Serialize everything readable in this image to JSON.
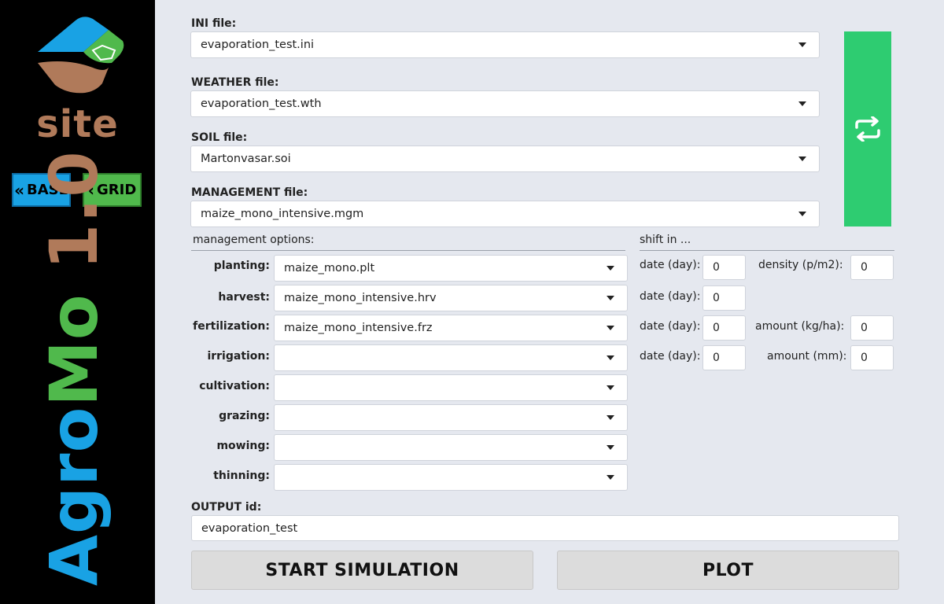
{
  "sidebar": {
    "site_text": "site",
    "base_label": "BASE",
    "grid_label": "GRID",
    "brand_part1": "Agro",
    "brand_part2": "Mo",
    "brand_part3": " 1.0",
    "colors": {
      "blue": "#19a2e4",
      "green": "#50b94c",
      "brown": "#b07a5a",
      "background": "#000000"
    }
  },
  "files": {
    "ini_label": "INI file:",
    "ini_value": "evaporation_test.ini",
    "weather_label": "WEATHER file:",
    "weather_value": "evaporation_test.wth",
    "soil_label": "SOIL file:",
    "soil_value": "Martonvasar.soi",
    "management_label": "MANAGEMENT file:",
    "management_value": "maize_mono_intensive.mgm",
    "refresh_icon": "refresh-icon",
    "refresh_color": "#2ecc71"
  },
  "management": {
    "title": "management options:",
    "options": [
      {
        "label": "planting:",
        "value": "maize_mono.plt"
      },
      {
        "label": "harvest:",
        "value": "maize_mono_intensive.hrv"
      },
      {
        "label": "fertilization:",
        "value": "maize_mono_intensive.frz"
      },
      {
        "label": "irrigation:",
        "value": ""
      },
      {
        "label": "cultivation:",
        "value": ""
      },
      {
        "label": "grazing:",
        "value": ""
      },
      {
        "label": "mowing:",
        "value": ""
      },
      {
        "label": "thinning:",
        "value": ""
      }
    ]
  },
  "shift": {
    "title": "shift in ...",
    "rows": [
      {
        "date_label": "date (day):",
        "date_value": "0",
        "extra_label": "density (p/m2):",
        "extra_value": "0"
      },
      {
        "date_label": "date (day):",
        "date_value": "0"
      },
      {
        "date_label": "date (day):",
        "date_value": "0",
        "extra_label": "amount (kg/ha):",
        "extra_value": "0"
      },
      {
        "date_label": "date (day):",
        "date_value": "0",
        "extra_label": "amount (mm):",
        "extra_value": "0"
      }
    ]
  },
  "output": {
    "label": "OUTPUT id:",
    "value": "evaporation_test"
  },
  "actions": {
    "start_label": "START SIMULATION",
    "plot_label": "PLOT"
  }
}
